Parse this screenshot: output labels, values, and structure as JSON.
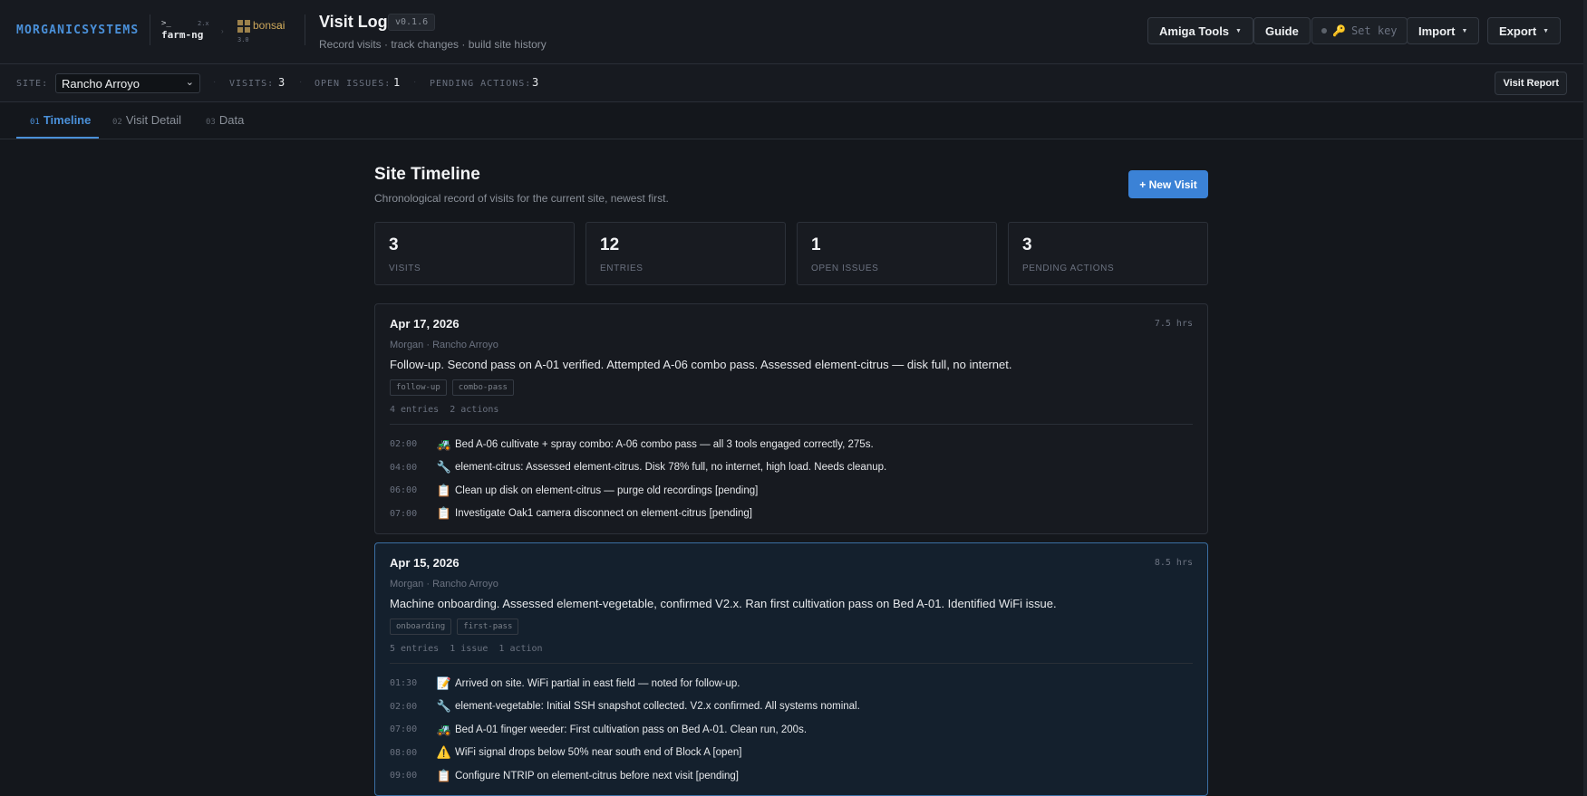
{
  "header": {
    "brand": "MORGANICSYSTEMS",
    "farmng": {
      "prompt": ">_",
      "name": "farm-ng",
      "version": "2.x"
    },
    "bonsai": {
      "name_a": "bons",
      "name_b": "ai",
      "version": "3.0"
    },
    "app_title": "Visit Log",
    "app_version": "v0.1.6",
    "app_subtitle": "Record visits · track changes · build site history",
    "buttons": {
      "amiga_tools": "Amiga Tools",
      "guide": "Guide",
      "set_key": "Set key",
      "import": "Import",
      "export": "Export"
    }
  },
  "sitebar": {
    "site_label": "SITE:",
    "site_value": "Rancho Arroyo",
    "visits_label": "VISITS:",
    "visits_value": "3",
    "open_issues_label": "OPEN ISSUES:",
    "open_issues_value": "1",
    "pending_label": "PENDING ACTIONS:",
    "pending_value": "3",
    "report_button": "Visit Report"
  },
  "tabs": [
    {
      "num": "01",
      "label": "Timeline"
    },
    {
      "num": "02",
      "label": "Visit Detail"
    },
    {
      "num": "03",
      "label": "Data"
    }
  ],
  "main": {
    "title": "Site Timeline",
    "subtitle": "Chronological record of visits for the current site, newest first.",
    "new_visit_button": "+ New Visit",
    "stats": [
      {
        "value": "3",
        "label": "Visits"
      },
      {
        "value": "12",
        "label": "Entries"
      },
      {
        "value": "1",
        "label": "Open Issues"
      },
      {
        "value": "3",
        "label": "Pending Actions"
      }
    ],
    "visits": [
      {
        "date": "Apr 17, 2026",
        "hours": "7.5 hrs",
        "meta": "Morgan · Rancho Arroyo",
        "summary": "Follow-up. Second pass on A-01 verified. Attempted A-06 combo pass. Assessed element-citrus — disk full, no internet.",
        "tags": [
          "follow-up",
          "combo-pass"
        ],
        "counts": "4 entries  2 actions",
        "entries": [
          {
            "time": "02:00",
            "icon": "🚜",
            "text": "Bed A-06 cultivate + spray combo: A-06 combo pass — all 3 tools engaged correctly, 275s."
          },
          {
            "time": "04:00",
            "icon": "🔧",
            "text": "element-citrus: Assessed element-citrus. Disk 78% full, no internet, high load. Needs cleanup."
          },
          {
            "time": "06:00",
            "icon": "📋",
            "text": "Clean up disk on element-citrus — purge old recordings [pending]"
          },
          {
            "time": "07:00",
            "icon": "📋",
            "text": "Investigate Oak1 camera disconnect on element-citrus [pending]"
          }
        ]
      },
      {
        "date": "Apr 15, 2026",
        "hours": "8.5 hrs",
        "meta": "Morgan · Rancho Arroyo",
        "summary": "Machine onboarding. Assessed element-vegetable, confirmed V2.x. Ran first cultivation pass on Bed A-01. Identified WiFi issue.",
        "tags": [
          "onboarding",
          "first-pass"
        ],
        "counts": "5 entries  1 issue  1 action",
        "entries": [
          {
            "time": "01:30",
            "icon": "📝",
            "text": "Arrived on site. WiFi partial in east field — noted for follow-up."
          },
          {
            "time": "02:00",
            "icon": "🔧",
            "text": "element-vegetable: Initial SSH snapshot collected. V2.x confirmed. All systems nominal."
          },
          {
            "time": "07:00",
            "icon": "🚜",
            "text": "Bed A-01 finger weeder: First cultivation pass on Bed A-01. Clean run, 200s."
          },
          {
            "time": "08:00",
            "icon": "⚠️",
            "text": "WiFi signal drops below 50% near south end of Block A [open]"
          },
          {
            "time": "09:00",
            "icon": "📋",
            "text": "Configure NTRIP on element-citrus before next visit [pending]"
          }
        ]
      }
    ]
  }
}
